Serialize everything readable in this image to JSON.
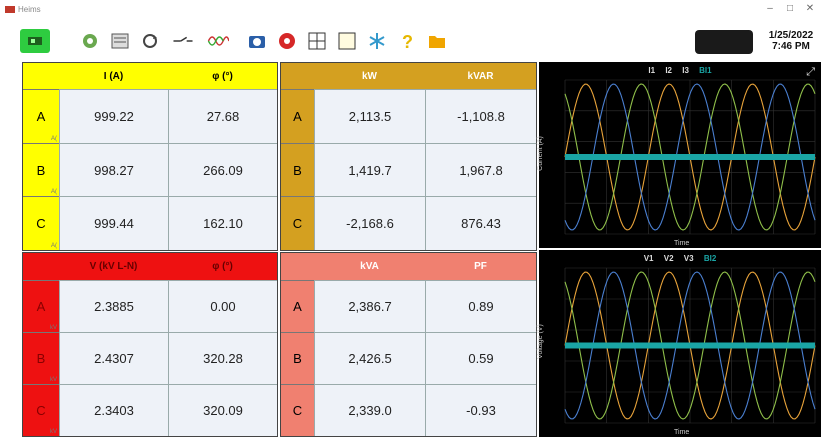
{
  "window": {
    "title": "Heims",
    "min": "–",
    "max": "□",
    "close": "✕"
  },
  "toolbar": {
    "icons": [
      "connect-icon",
      "settings-gear-icon",
      "meter-icon",
      "rotation-icon",
      "probe-icon",
      "waveform-icon",
      "camera-icon",
      "record-icon",
      "grid-layout-icon",
      "window-icon",
      "snowflake-icon",
      "help-icon",
      "folder-icon"
    ],
    "date": "1/25/2022",
    "time": "7:46 PM"
  },
  "current_table": {
    "header": [
      "I (A)",
      "φ (°)"
    ],
    "rows": [
      {
        "label": "A",
        "sub": "A(",
        "value": "999.22",
        "angle": "27.68"
      },
      {
        "label": "B",
        "sub": "A(",
        "value": "998.27",
        "angle": "266.09"
      },
      {
        "label": "C",
        "sub": "A(",
        "value": "999.44",
        "angle": "162.10"
      }
    ]
  },
  "power_table": {
    "header": [
      "kW",
      "kVAR"
    ],
    "rows": [
      {
        "label": "A",
        "kw": "2,113.5",
        "kvar": "-1,108.8"
      },
      {
        "label": "B",
        "kw": "1,419.7",
        "kvar": "1,967.8"
      },
      {
        "label": "C",
        "kw": "-2,168.6",
        "kvar": "876.43"
      }
    ]
  },
  "voltage_table": {
    "header": [
      "V (kV L-N)",
      "φ (°)"
    ],
    "rows": [
      {
        "label": "A",
        "sub": "kV",
        "value": "2.3885",
        "angle": "0.00"
      },
      {
        "label": "B",
        "sub": "kV",
        "value": "2.4307",
        "angle": "320.28"
      },
      {
        "label": "C",
        "sub": "kV",
        "value": "2.3403",
        "angle": "320.09"
      }
    ]
  },
  "apparent_table": {
    "header": [
      "kVA",
      "PF"
    ],
    "rows": [
      {
        "label": "A",
        "kva": "2,386.7",
        "pf": "0.89"
      },
      {
        "label": "B",
        "kva": "2,426.5",
        "pf": "0.59"
      },
      {
        "label": "C",
        "kva": "2,339.0",
        "pf": "-0.93"
      }
    ]
  },
  "current_chart": {
    "legend": [
      "I1",
      "I2",
      "I3",
      "BI1"
    ],
    "ylabel": "Current (A)",
    "xlabel": "Time",
    "colors": [
      "#e8a33a",
      "#8fbf4a",
      "#4a7fd0",
      "#1aa5a5"
    ]
  },
  "voltage_chart": {
    "legend": [
      "V1",
      "V2",
      "V3",
      "BI2"
    ],
    "ylabel": "Voltage (V)",
    "xlabel": "Time",
    "colors": [
      "#e8a33a",
      "#8fbf4a",
      "#4a7fd0",
      "#1aa5a5"
    ]
  },
  "colors": {
    "current_header": "#ffff00",
    "power_header": "#d4a020",
    "voltage_header": "#ee1111",
    "apparent_header": "#f08070",
    "toolbar_green": "#2ecc40"
  }
}
